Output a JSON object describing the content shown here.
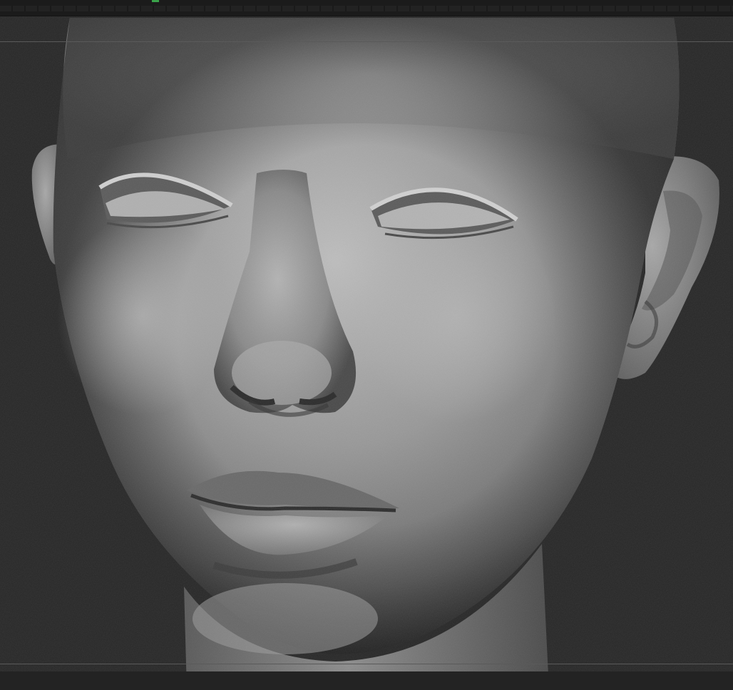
{
  "app": {
    "name": "",
    "active_tool": "sculpt-viewport"
  },
  "colors": {
    "background": "#272727",
    "shelf": "#1b1b1b",
    "guide_line": "#5a5a5a",
    "clay_highlight": "#c9c9c9",
    "clay_mid": "#8e8e8e",
    "clay_shadow": "#3a3a3a",
    "active_indicator": "#3aa24a"
  },
  "viewport": {
    "subject": "head-sculpt-model",
    "material": "matcap-gray-clay"
  }
}
